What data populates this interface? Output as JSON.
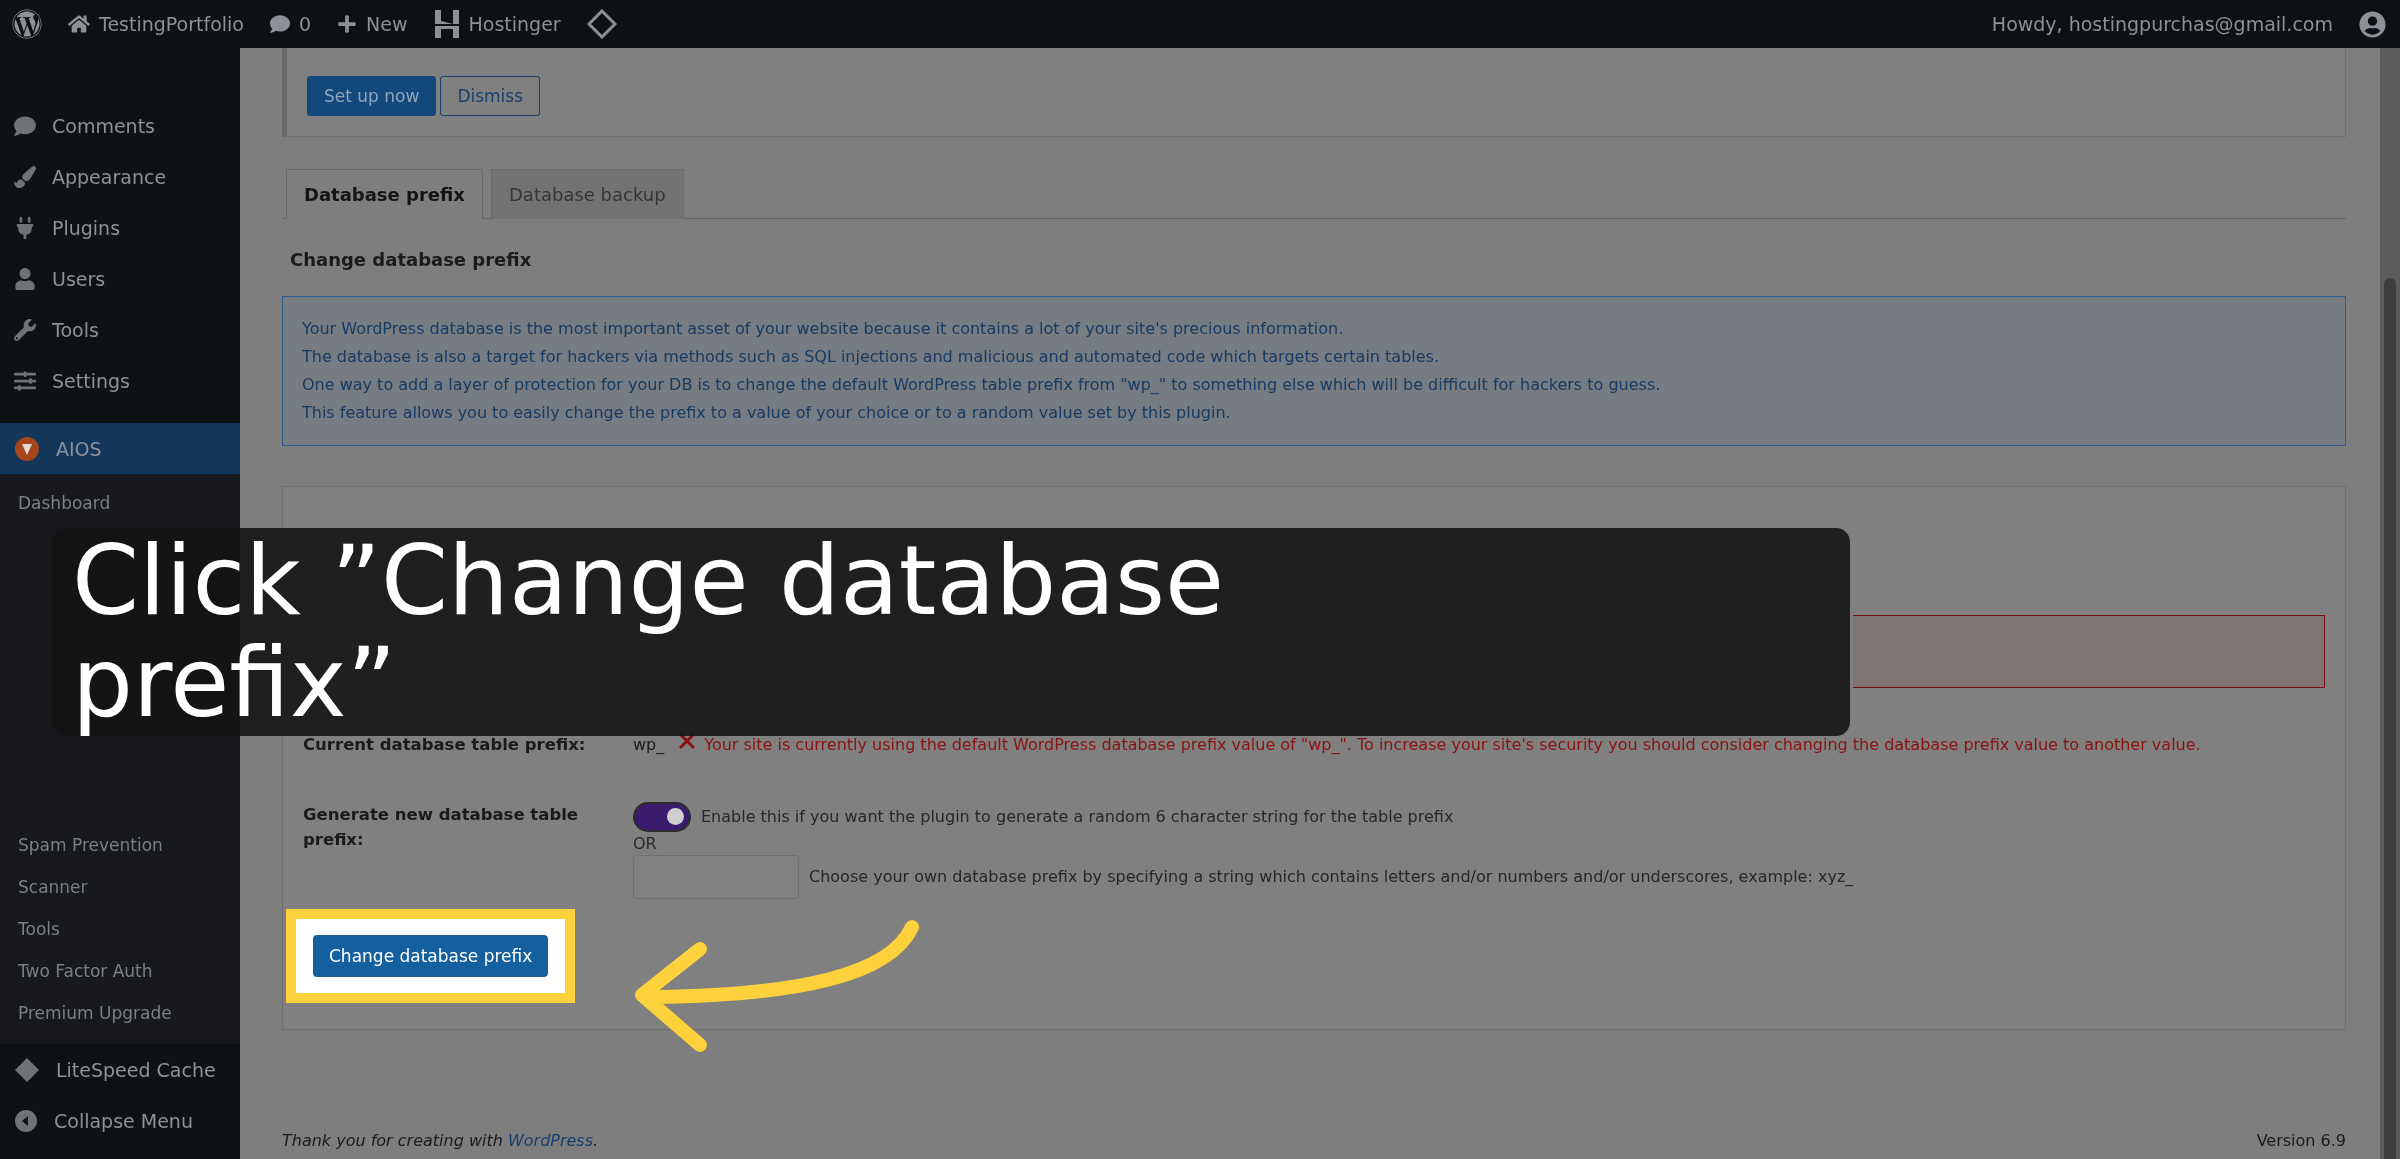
{
  "top_bar": {
    "site": "TestingPortfolio",
    "comments": "0",
    "new": "New",
    "hostinger": "Hostinger",
    "account": "Howdy, hostingpurchas@gmail.com"
  },
  "sidebar": {
    "items": [
      {
        "label": "Comments",
        "selected": false
      },
      {
        "label": "Appearance",
        "selected": false
      },
      {
        "label": "Plugins",
        "selected": false
      },
      {
        "label": "Users",
        "selected": false
      },
      {
        "label": "Tools",
        "selected": false
      },
      {
        "label": "Settings",
        "selected": false
      },
      {
        "label": "AIOS",
        "selected": true
      }
    ],
    "submenu_top": [
      "Dashboard"
    ],
    "submenu_bottom": [
      "Spam Prevention",
      "Scanner",
      "Tools",
      "Two Factor Auth",
      "Premium Upgrade"
    ],
    "after": [
      {
        "label": "LiteSpeed Cache",
        "kind": "plugin"
      },
      {
        "label": "Collapse Menu",
        "kind": "collapse"
      }
    ]
  },
  "notice": {
    "buttons": [
      {
        "label": "Set up now",
        "kind": "primary"
      },
      {
        "label": "Dismiss",
        "kind": "secondary"
      }
    ]
  },
  "tabs": [
    {
      "label": "Database prefix",
      "selected": true
    },
    {
      "label": "Database backup",
      "selected": false
    }
  ],
  "section_title": "Change database prefix",
  "info_lines": [
    "Your WordPress database is the most important asset of your website because it contains a lot of your site's precious information.",
    "The database is also a target for hackers via methods such as SQL injections and malicious and automated code which targets certain tables.",
    "One way to add a layer of protection for your DB is to change the default WordPress table prefix from \"wp_\" to something else which will be difficult for hackers to guess.",
    "This feature allows you to easily change the prefix to a value of your choice or to a random value set by this plugin."
  ],
  "options": {
    "current_label": "Current database table prefix:",
    "current_value": "wp_",
    "warning": "Your site is currently using the default WordPress database prefix value of \"wp_\". To increase your site's security you should consider changing the database prefix value to another value.",
    "generate_label": "Generate new database table prefix:",
    "toggle": {
      "on": true,
      "text": "Enable this if you want the plugin to generate a random 6 character string for the table prefix"
    },
    "or": "OR",
    "custom_hint": "Choose your own database prefix by specifying a string which contains letters and/or numbers and/or underscores, example: xyz_",
    "submit": "Change database prefix"
  },
  "footer": {
    "thanks": "Thank you for creating with ",
    "link": "WordPress",
    "end": ".",
    "version": "Version 6.9"
  },
  "caption": "Click ”Change database prefix”"
}
